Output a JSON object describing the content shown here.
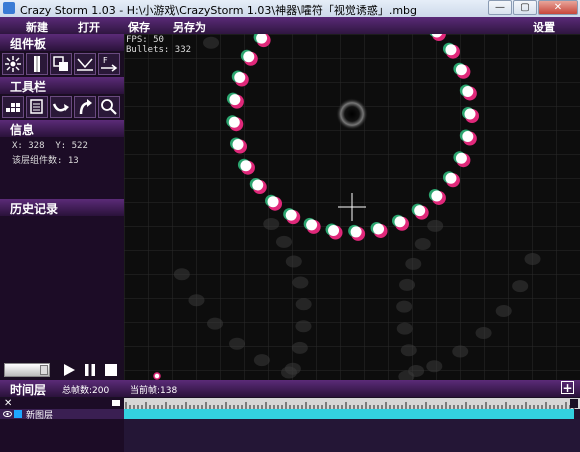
{
  "window": {
    "title": "Crazy Storm 1.03 - H:\\小游戏\\CrazyStorm 1.03\\神器\\嚯符「视觉诱惑」.mbg",
    "buttons": {
      "minimize": "—",
      "maximize": "▢",
      "close": "✕"
    }
  },
  "menu": {
    "new": "新建",
    "open": "打开",
    "save": "保存",
    "save_as": "另存为",
    "settings": "设置"
  },
  "panels": {
    "components": {
      "title": "组件板",
      "tools": [
        "emitter-icon",
        "laser-icon",
        "layer-copy-icon",
        "reflect-icon",
        "force-icon"
      ]
    },
    "toolbar": {
      "title": "工具栏",
      "tools": [
        "grid-icon",
        "layers-icon",
        "curve-arrow-icon",
        "rotate-arrow-icon",
        "zoom-icon"
      ]
    },
    "info": {
      "title": "信息",
      "x_label": "X:",
      "x_value": "328",
      "y_label": "Y:",
      "y_value": "522",
      "count_label": "该层组件数:",
      "count_value": "13"
    },
    "history": {
      "title": "历史记录"
    }
  },
  "canvas": {
    "fps_label": "FPS:",
    "fps_value": "50",
    "bullets_label": "Bullets:",
    "bullets_value": "332"
  },
  "timeline": {
    "title": "时间层",
    "total_frames_label": "总帧数:",
    "total_frames_value": "200",
    "current_frame_label": "当前帧:",
    "current_frame_value": "138",
    "add_label": "+",
    "close_label": "✕",
    "layers": [
      {
        "name": "新图层",
        "color": "#1ea7ff"
      }
    ]
  },
  "colors": {
    "accent": "#5a2a78",
    "bullet_ring": "#e0287a",
    "bullet_core": "#ffffff",
    "layer_bar": "#33d1e0"
  }
}
